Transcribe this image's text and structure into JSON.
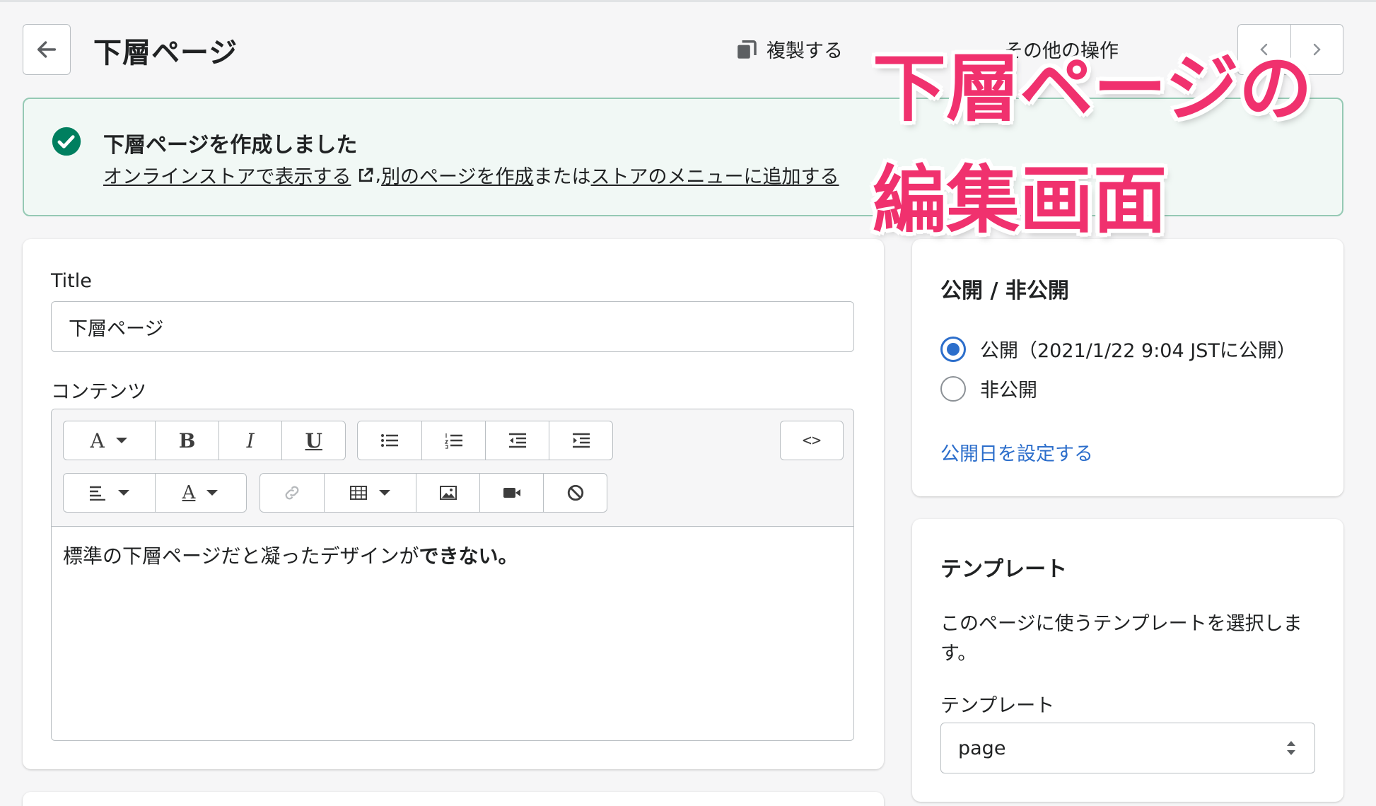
{
  "header": {
    "title": "下層ページ",
    "duplicate_label": "複製する",
    "more_label": "その他の操作"
  },
  "banner": {
    "title": "下層ページを作成しました",
    "link_view": "オンラインストアで表示する",
    "separator": " , ",
    "link_create": "別のページを作成",
    "middle_text": "または",
    "link_menu": "ストアのメニューに追加する"
  },
  "overlay": {
    "line1": "下層ページの",
    "line2": "編集画面"
  },
  "main": {
    "title_label": "Title",
    "title_value": "下層ページ",
    "content_label": "コンテンツ",
    "content_text_normal": "標準の下層ページだと凝ったデザインが",
    "content_text_bold": "できない。",
    "toolbar": {
      "font_label": "A",
      "bold_label": "B",
      "italic_label": "I",
      "underline_label": "U",
      "html_label": "<>",
      "color_label": "A"
    }
  },
  "visibility": {
    "title": "公開 / 非公開",
    "published_label": "公開（2021/1/22 9:04 JSTに公開）",
    "hidden_label": "非公開",
    "set_date_link": "公開日を設定する"
  },
  "template": {
    "title": "テンプレート",
    "description": "このページに使うテンプレートを選択します。",
    "select_label": "テンプレート",
    "select_value": "page"
  },
  "colors": {
    "accent": "#2c6ecb",
    "success": "#007f5f",
    "overlay": "#f0316e"
  }
}
